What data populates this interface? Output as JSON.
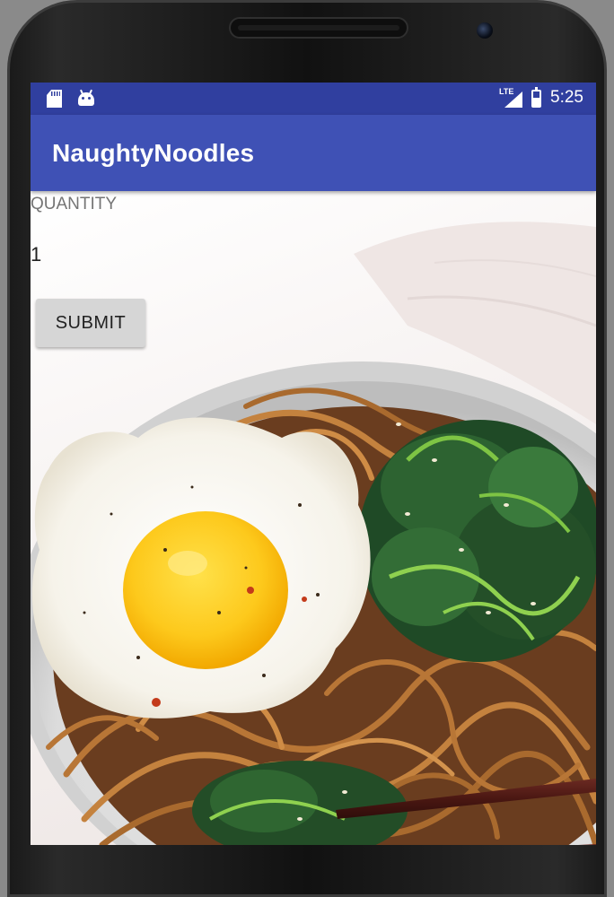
{
  "status_bar": {
    "network_label": "LTE",
    "time": "5:25",
    "icons": [
      "sd-card-icon",
      "android-icon",
      "signal-icon",
      "battery-icon"
    ],
    "background_color": "#303f9f"
  },
  "app_bar": {
    "title": "NaughtyNoodles",
    "background_color": "#3f51b5"
  },
  "form": {
    "quantity_label": "QUANTITY",
    "quantity_value": "1",
    "submit_label": "SUBMIT"
  },
  "background_image": {
    "subject": "bowl of noodles with fried egg, spinach and chopsticks"
  }
}
